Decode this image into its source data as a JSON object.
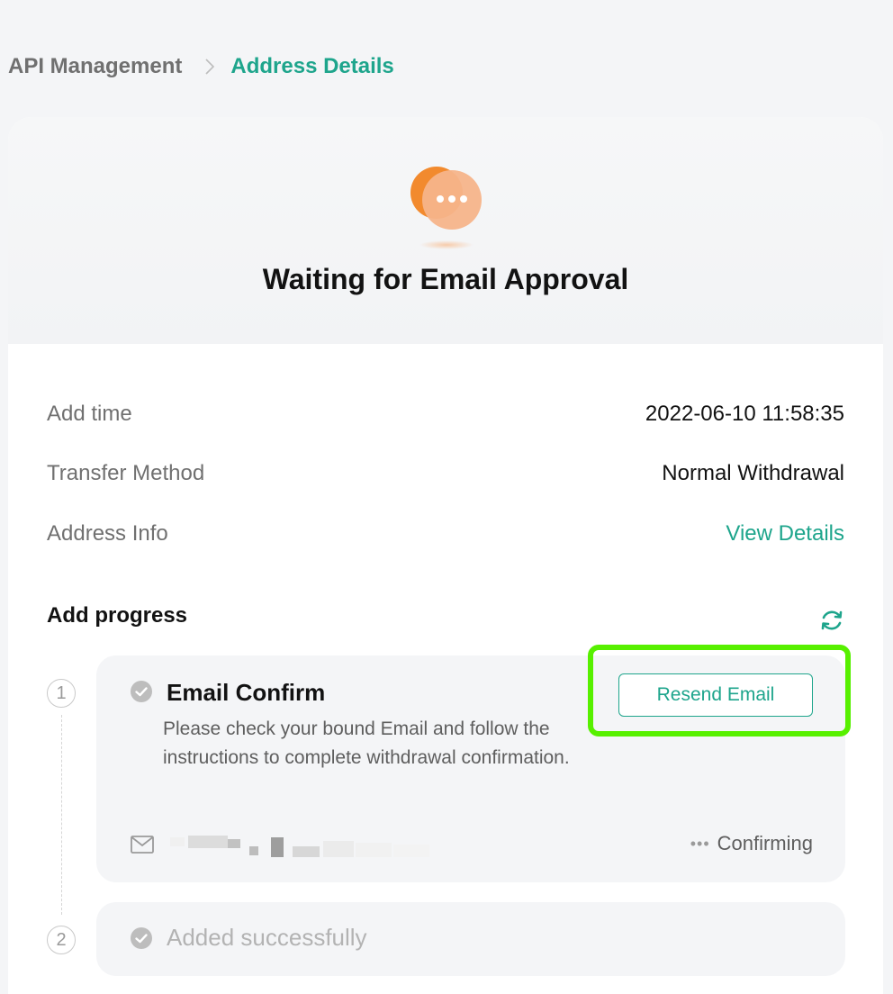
{
  "breadcrumb": {
    "parent": "API Management",
    "current": "Address Details"
  },
  "status": {
    "title": "Waiting for Email Approval",
    "icon": "chat-bubble-ellipsis-icon",
    "accent_color": "#f28a2e"
  },
  "info": {
    "add_time": {
      "label": "Add time",
      "value": "2022-06-10 11:58:35"
    },
    "transfer_method": {
      "label": "Transfer Method",
      "value": "Normal Withdrawal"
    },
    "address_info": {
      "label": "Address Info",
      "link": "View Details"
    }
  },
  "progress": {
    "title": "Add progress",
    "steps": [
      {
        "number": "1",
        "title": "Email Confirm",
        "description": "Please check your bound Email and follow the instructions to complete withdrawal confirmation.",
        "button": "Resend Email",
        "status": "Confirming"
      },
      {
        "number": "2",
        "title": "Added successfully"
      }
    ]
  },
  "colors": {
    "brand": "#1ea58c",
    "highlight": "#57f000"
  }
}
